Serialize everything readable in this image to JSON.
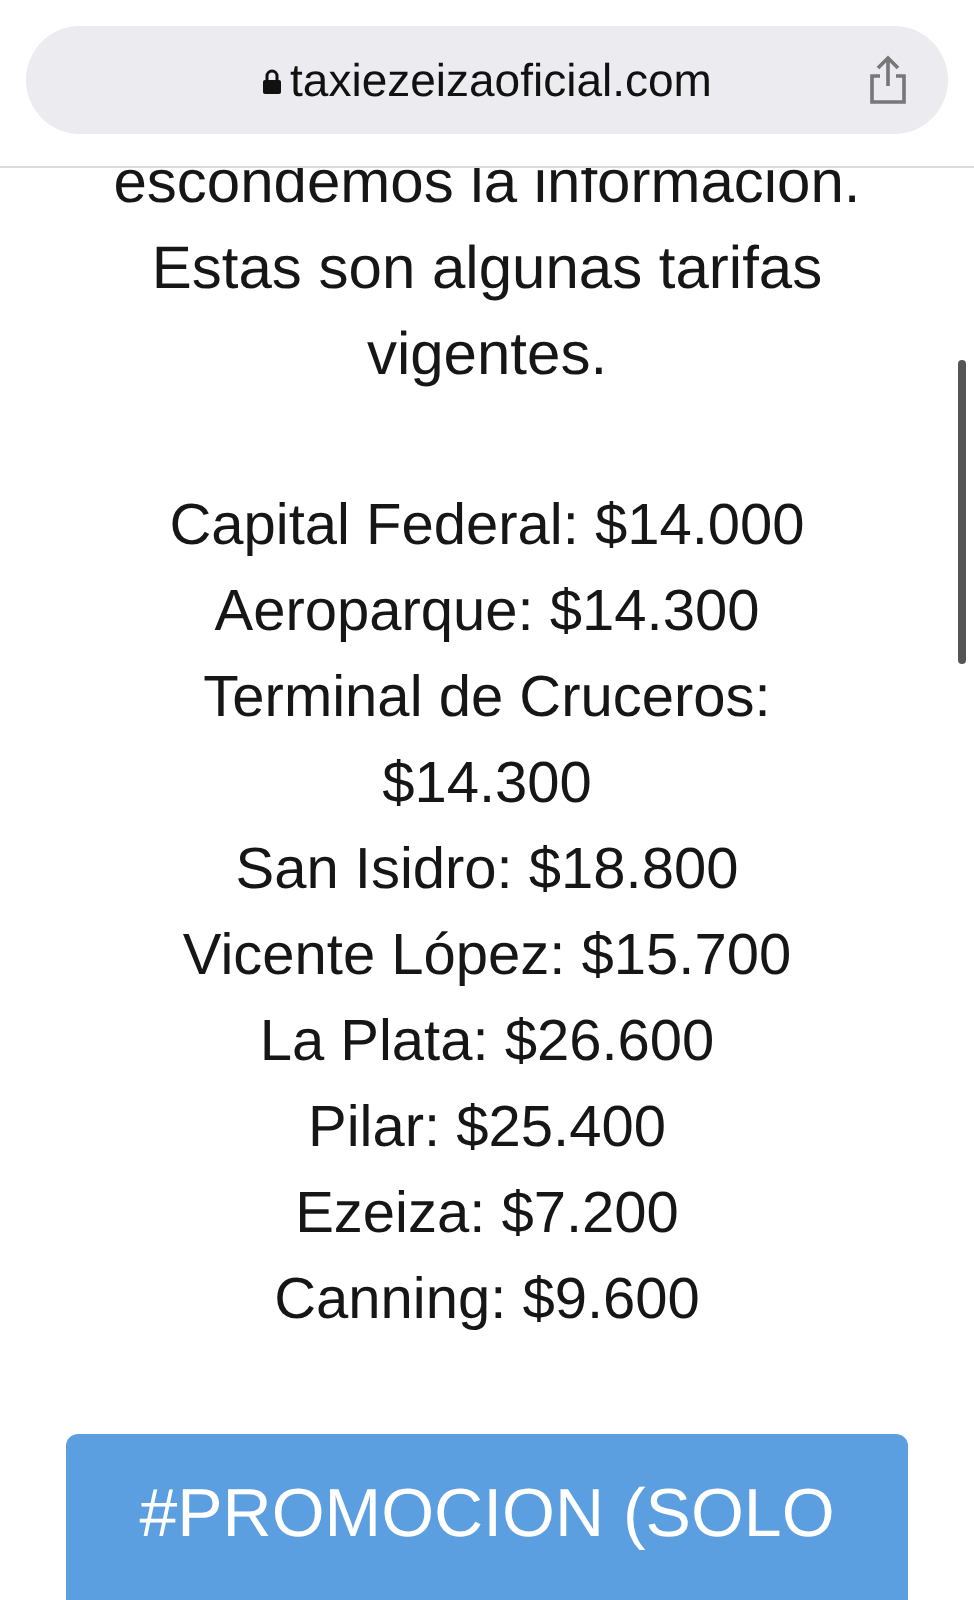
{
  "address_bar": {
    "url": "taxiezeizaoficial.com",
    "secure": true
  },
  "intro": "escondemos la informacion. Estas son algunas tarifas vigentes.",
  "rates": [
    {
      "text": "Capital Federal: $14.000"
    },
    {
      "text": "Aeroparque: $14.300"
    },
    {
      "text": "Terminal de Cruceros: $14.300"
    },
    {
      "text": "San Isidro: $18.800"
    },
    {
      "text": "Vicente López: $15.700"
    },
    {
      "text": "La Plata: $26.600"
    },
    {
      "text": "Pilar: $25.400"
    },
    {
      "text": "Ezeiza: $7.200"
    },
    {
      "text": "Canning: $9.600"
    }
  ],
  "promo_button": {
    "label": "#PROMOCION (SOLO"
  }
}
